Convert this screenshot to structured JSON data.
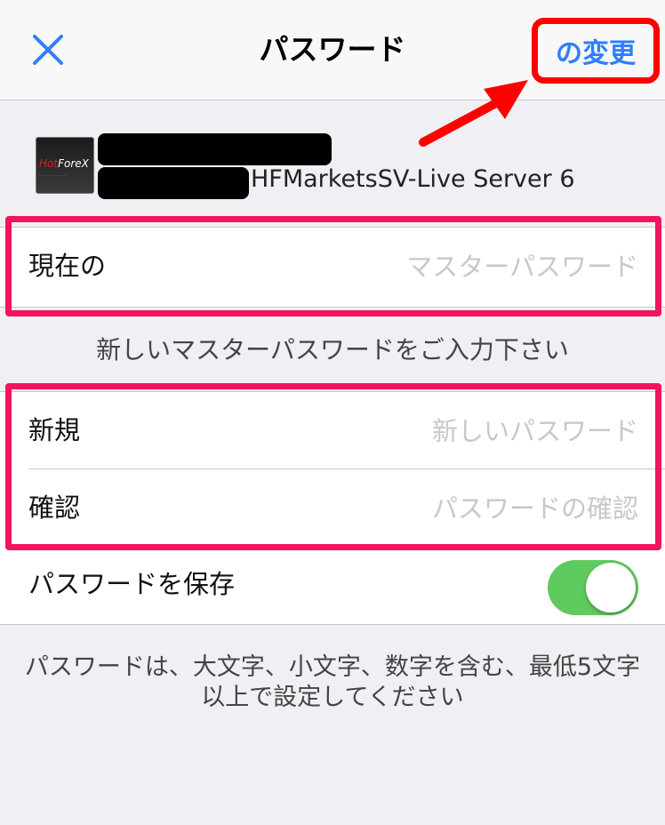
{
  "navbar": {
    "title": "パスワード",
    "close_icon": "close-icon",
    "change_label": "の変更",
    "accent": "#2d7ff9"
  },
  "account": {
    "logo_icon": "hotforex-logo",
    "logo_text_hot": "Hot",
    "logo_text_forex": "ForeX",
    "server": "HFMarketsSV-Live Server 6"
  },
  "current": {
    "label": "現在の",
    "placeholder": "マスターパスワード",
    "value": ""
  },
  "prompt": "新しいマスターパスワードをご入力下さい",
  "new_password": {
    "label": "新規",
    "placeholder": "新しいパスワード",
    "value": ""
  },
  "confirm_password": {
    "label": "確認",
    "placeholder": "パスワードの確認",
    "value": ""
  },
  "save_password": {
    "label": "パスワードを保存",
    "enabled": true,
    "toggle_color": "#5fca5e"
  },
  "note_lines": [
    "パスワードは、大文字、小文字、数字を含む、最低5文字",
    "以上で設定してください"
  ],
  "annotation_color": "#f0155d"
}
